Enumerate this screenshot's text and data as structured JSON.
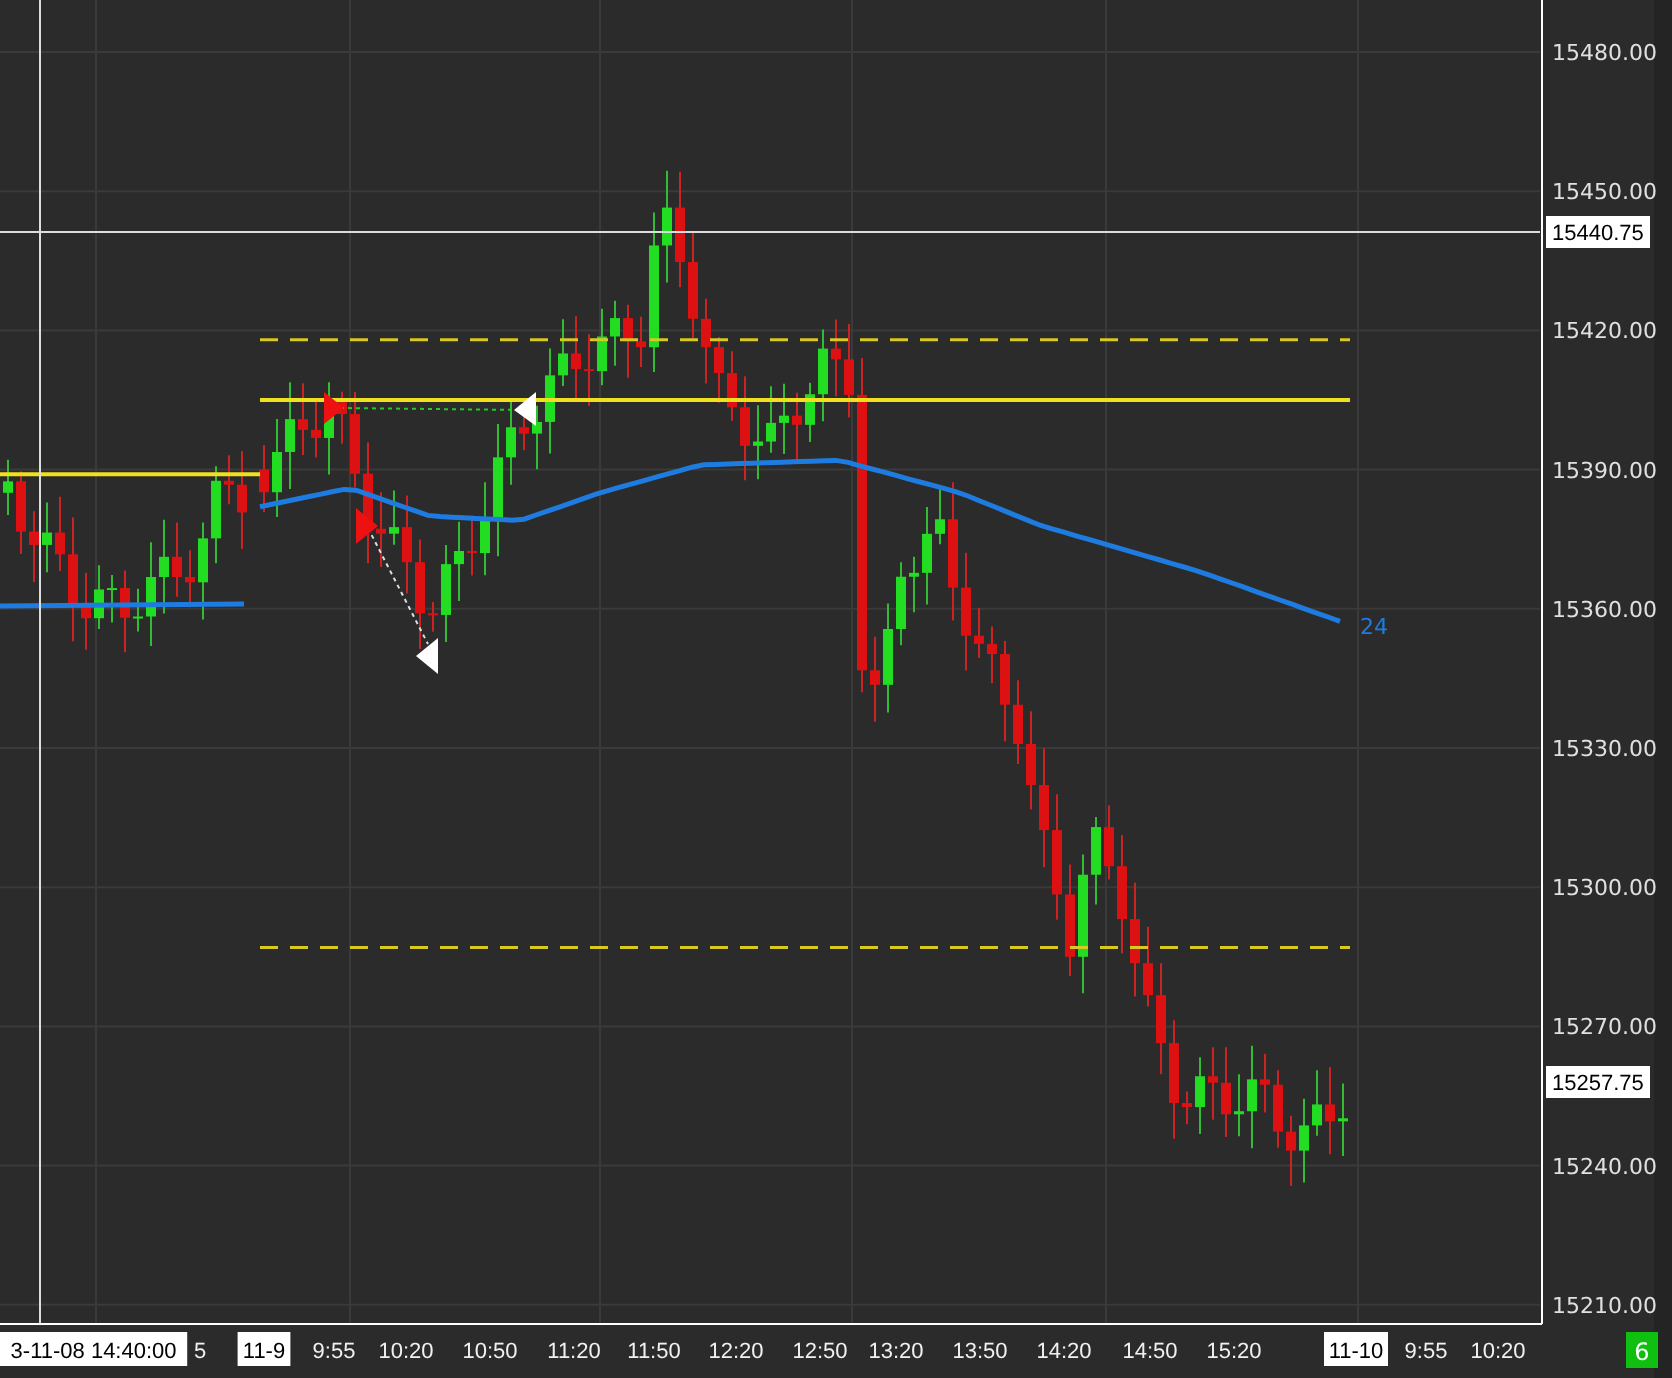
{
  "price_axis": {
    "labels": [
      "15480.00",
      "15450.00",
      "15420.00",
      "15390.00",
      "15360.00",
      "15330.00",
      "15300.00",
      "15270.00",
      "15240.00",
      "15210.00"
    ],
    "crosshair_price": "15440.75",
    "last_price": "15257.75"
  },
  "indicator_label": "24",
  "time_axis": {
    "labels": [
      {
        "kind": "date",
        "text": "3-11-08 14:40:00"
      },
      {
        "kind": "time",
        "text": "5"
      },
      {
        "kind": "date",
        "text": "11-9"
      },
      {
        "kind": "time",
        "text": "9:55"
      },
      {
        "kind": "time",
        "text": "10:20"
      },
      {
        "kind": "time",
        "text": "10:50"
      },
      {
        "kind": "time",
        "text": "11:20"
      },
      {
        "kind": "time",
        "text": "11:50"
      },
      {
        "kind": "time",
        "text": "12:20"
      },
      {
        "kind": "time",
        "text": "12:50"
      },
      {
        "kind": "time",
        "text": "13:20"
      },
      {
        "kind": "time",
        "text": "13:50"
      },
      {
        "kind": "time",
        "text": "14:20"
      },
      {
        "kind": "time",
        "text": "14:50"
      },
      {
        "kind": "time",
        "text": "15:20"
      },
      {
        "kind": "date",
        "text": "11-10"
      },
      {
        "kind": "time",
        "text": "9:55"
      },
      {
        "kind": "time",
        "text": "10:20"
      }
    ]
  },
  "badge": "6"
}
